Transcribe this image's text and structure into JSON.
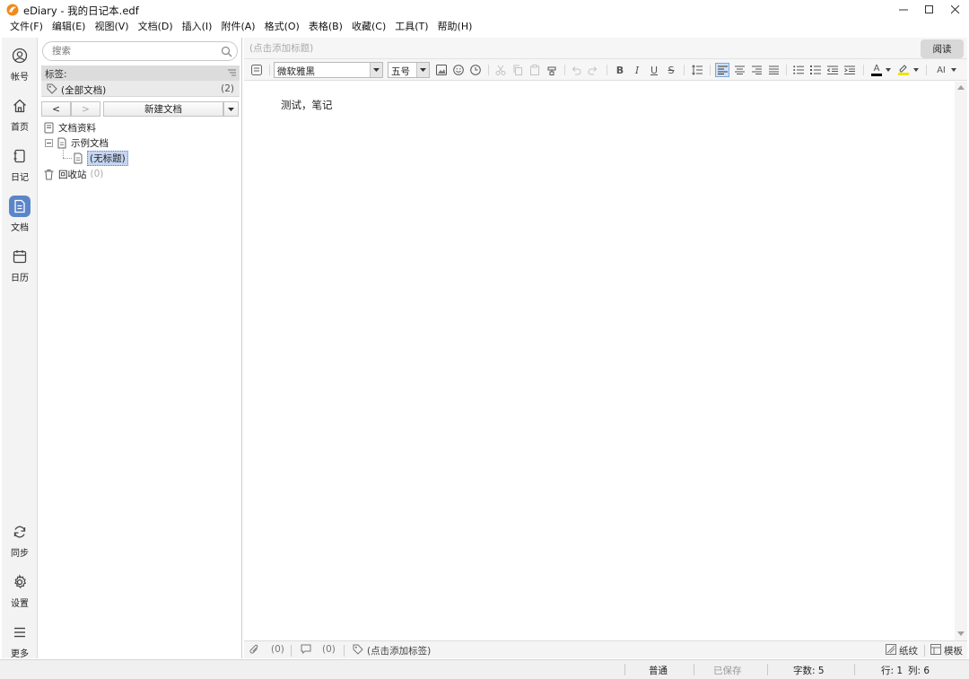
{
  "window": {
    "title": "eDiary - 我的日记本.edf",
    "controls": [
      "minimize",
      "maximize",
      "close"
    ]
  },
  "menu": [
    "文件(F)",
    "编辑(E)",
    "视图(V)",
    "文档(D)",
    "插入(I)",
    "附件(A)",
    "格式(O)",
    "表格(B)",
    "收藏(C)",
    "工具(T)",
    "帮助(H)"
  ],
  "nav": {
    "account": "帐号",
    "home": "首页",
    "diary": "日记",
    "docs": "文档",
    "calendar": "日历",
    "sync": "同步",
    "settings": "设置",
    "more": "更多",
    "active": "docs"
  },
  "left_panel": {
    "search_placeholder": "搜索",
    "tags_label": "标签:",
    "all_docs_label": "(全部文档)",
    "all_docs_count": "(2)",
    "back_label": "<",
    "forward_label": ">",
    "new_doc_label": "新建文档",
    "tree": {
      "root": "文档资料",
      "folder": "示例文档",
      "doc": "(无标题)",
      "recycle": "回收站",
      "recycle_count": "(0)"
    }
  },
  "editor": {
    "title_placeholder": "(点击添加标题)",
    "read_button": "阅读",
    "font_family": "微软雅黑",
    "font_size": "五号",
    "content": "测试，笔记"
  },
  "bottom": {
    "attach_count": "(0)",
    "comment_count": "(0)",
    "tag_placeholder": "(点击添加标签)",
    "paper_label": "纸纹",
    "template_label": "模板"
  },
  "status": {
    "mode": "普通",
    "save_state": "已保存",
    "word_count": "字数: 5",
    "row": "行: 1",
    "col": "列: 6"
  },
  "colors": {
    "accent": "#5b85c9",
    "selection": "#c5d6f2",
    "font_color_bar": "#000000",
    "highlight_bar": "#f2e200"
  }
}
